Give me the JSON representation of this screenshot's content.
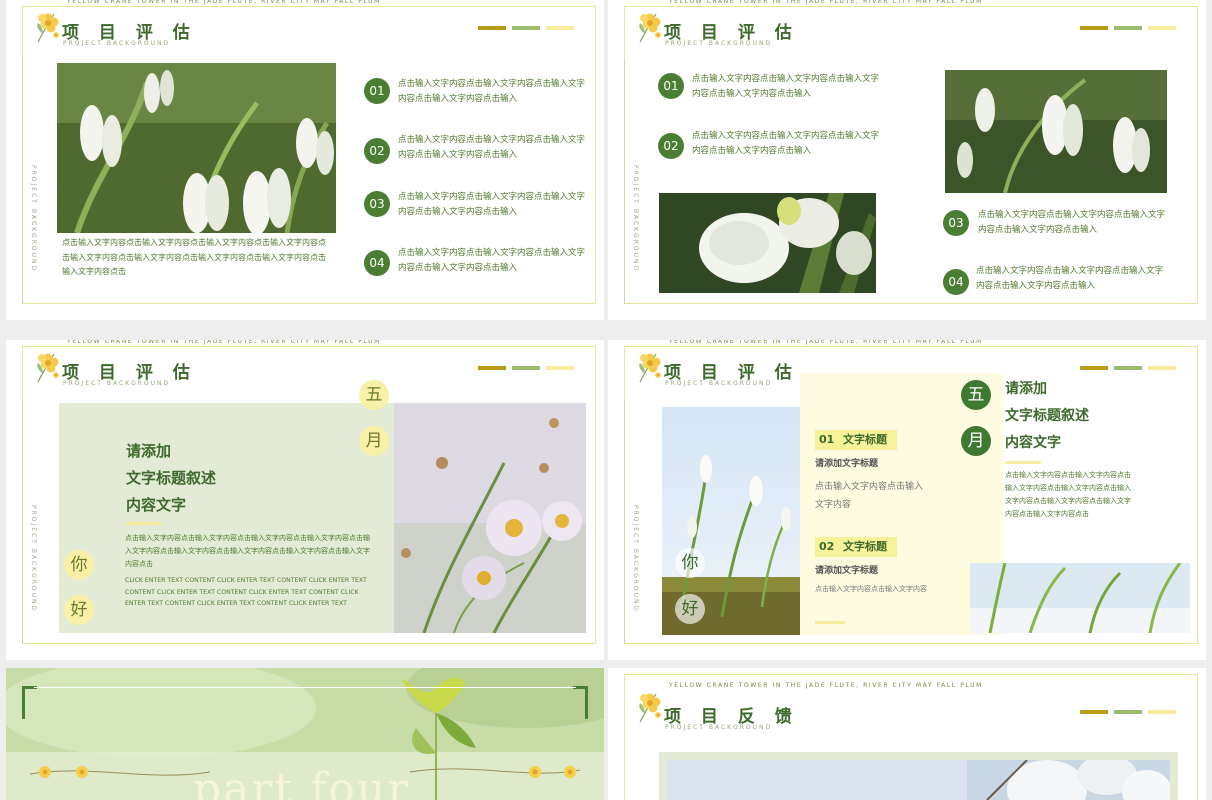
{
  "colors": {
    "accent_dark_green": "#3d6a2c",
    "bar_olive": "#b99a17",
    "bar_light_green": "#9dbb6f",
    "bar_pale_yellow": "#f6ee9e"
  },
  "common": {
    "tagline": "YELLOW CRANE TOWER IN THE JADE FLUTE, RIVER CITY MAY FALL PLUM",
    "subtitle": "PROJECT BACKGROUND",
    "vertical": "PROJECT BACKGROUND"
  },
  "slide1": {
    "title": "项 目 评 估",
    "caption": "点击输入文字内容点击输入文字内容点击输入文字内容点击输入文字内容点击输入文字内容点击输入文字内容点击输入文字内容点击输入文字内容点击输入文字内容点击",
    "items": [
      {
        "num": "01",
        "text": "点击输入文字内容点击输入文字内容点击输入文字内容点击输入文字内容点击输入"
      },
      {
        "num": "02",
        "text": "点击输入文字内容点击输入文字内容点击输入文字内容点击输入文字内容点击输入"
      },
      {
        "num": "03",
        "text": "点击输入文字内容点击输入文字内容点击输入文字内容点击输入文字内容点击输入"
      },
      {
        "num": "04",
        "text": "点击输入文字内容点击输入文字内容点击输入文字内容点击输入文字内容点击输入"
      }
    ]
  },
  "slide2": {
    "title": "项 目 评 估",
    "items": [
      {
        "num": "01",
        "text": "点击输入文字内容点击输入文字内容点击输入文字内容点击输入文字内容点击输入"
      },
      {
        "num": "02",
        "text": "点击输入文字内容点击输入文字内容点击输入文字内容点击输入文字内容点击输入"
      },
      {
        "num": "03",
        "text": "点击输入文字内容点击输入文字内容点击输入文字内容点击输入文字内容点击输入"
      },
      {
        "num": "04",
        "text": "点击输入文字内容点击输入文字内容点击输入文字内容点击输入文字内容点击输入"
      }
    ]
  },
  "slide3": {
    "title": "项 目 评 估",
    "headline": [
      "请添加",
      "文字标题叙述",
      "内容文字"
    ],
    "body": "点击输入文字内容点击输入文字内容点击输入文字内容点击输入文字内容点击输入文字内容点击输入文字内容点击输入文字内容点击输入文字内容点击输入文字内容点击",
    "english": "CLICK ENTER TEXT CONTENT CLICK ENTER TEXT CONTENT CLICK ENTER TEXT CONTENT CLICK ENTER TEXT CONTENT CLICK ENTER TEXT CONTENT CLICK ENTER TEXT CONTENT CLICK ENTER TEXT CONTENT CLICK ENTER TEXT",
    "char_wu": "五",
    "char_yue": "月",
    "char_ni": "你",
    "char_hao": "好"
  },
  "slide4": {
    "title": "项 目 评 估",
    "char_wu": "五",
    "char_yue": "月",
    "char_ni": "你",
    "char_hao": "好",
    "headline": [
      "请添加",
      "文字标题叙述",
      "内容文字"
    ],
    "blocks": [
      {
        "num": "01",
        "label": "文字标题",
        "sub": "请添加文字标题",
        "text": "点击输入文字内容点击输入文字内容"
      },
      {
        "num": "02",
        "label": "文字标题",
        "sub": "请添加文字标题",
        "text": "点击输入文字内容点击输入文字内容"
      }
    ],
    "right_text": "点击输入文字内容点击输入文字内容点击输入文字内容点击输入文字内容点击输入文字内容点击输入文字内容点击输入文字内容点击输入文字内容点击"
  },
  "slide5": {
    "big_text": "part four"
  },
  "slide6": {
    "title": "项 目 反 馈"
  }
}
